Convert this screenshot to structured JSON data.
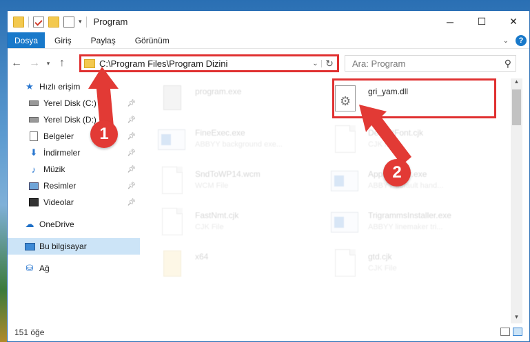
{
  "window": {
    "title": "Program"
  },
  "ribbon": {
    "tabs": [
      "Dosya",
      "Giriş",
      "Paylaş",
      "Görünüm"
    ],
    "help": "?"
  },
  "address": {
    "path": "C:\\Program Files\\Program Dizini",
    "search_placeholder": "Ara: Program"
  },
  "sidebar": {
    "quick_access": "Hızlı erişim",
    "items": [
      {
        "label": "Yerel Disk (C:)",
        "icon": "drive-icon"
      },
      {
        "label": "Yerel Disk (D:)",
        "icon": "drive-icon"
      },
      {
        "label": "Belgeler",
        "icon": "documents-icon"
      },
      {
        "label": "İndirmeler",
        "icon": "downloads-icon"
      },
      {
        "label": "Müzik",
        "icon": "music-icon"
      },
      {
        "label": "Resimler",
        "icon": "pictures-icon"
      },
      {
        "label": "Videolar",
        "icon": "videos-icon"
      }
    ],
    "onedrive": "OneDrive",
    "this_pc": "Bu bilgisayar",
    "network": "Ağ"
  },
  "files": [
    {
      "name": "program.exe",
      "desc": "",
      "kind": "setup"
    },
    {
      "name": "gri_yam.dll",
      "desc": "",
      "kind": "dll"
    },
    {
      "name": "FineExec.exe",
      "desc": "ABBYY background exe...",
      "kind": "exe"
    },
    {
      "name": "DefaultFont.cjk",
      "desc": "CJK File",
      "kind": "page"
    },
    {
      "name": "SndToWP14.wcm",
      "desc": "WCM File",
      "kind": "page"
    },
    {
      "name": "AppHandler.exe",
      "desc": "ABBYY default hand...",
      "kind": "exe"
    },
    {
      "name": "FastNmt.cjk",
      "desc": "CJK File",
      "kind": "page"
    },
    {
      "name": "TrigrammsInstaller.exe",
      "desc": "ABBYY linemaker tri...",
      "kind": "exe"
    },
    {
      "name": "x64",
      "desc": "",
      "kind": "folder"
    },
    {
      "name": "gtd.cjk",
      "desc": "CJK File",
      "kind": "page"
    }
  ],
  "status": {
    "count": "151 öğe"
  },
  "annotations": {
    "badge1": "1",
    "badge2": "2"
  },
  "colors": {
    "accent": "#1979ca",
    "annotation_red": "#e03030",
    "selection": "#cce4f7"
  }
}
